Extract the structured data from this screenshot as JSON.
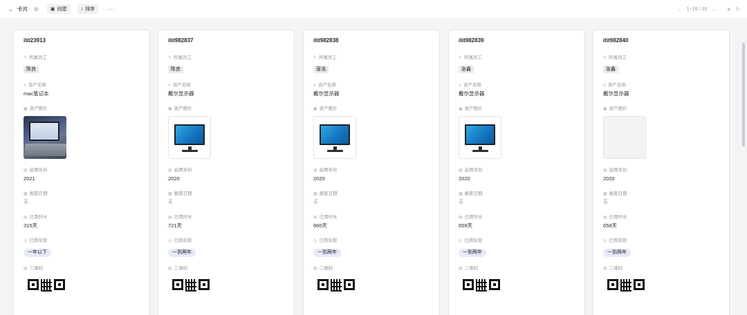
{
  "toolbar": {
    "view_name": "卡片",
    "create_label": "创建",
    "sort_label": "排序",
    "more_label": "···",
    "pagination": "1~16 / 16"
  },
  "fields": {
    "employee": "所属员工",
    "asset_name": "资产名称",
    "asset_image": "资产图片",
    "start_year": "启用年份",
    "scrap_date": "报废日期",
    "used_duration": "已用时长",
    "used_years": "已用年限",
    "qr_code": "二维码"
  },
  "cards": [
    {
      "id": "itit23913",
      "employee": "陈良",
      "asset_name": "mac笔记本",
      "image": "laptop",
      "start_year": "2021",
      "scrap_date": "无",
      "used_duration": "315天",
      "used_years": "一年以下"
    },
    {
      "id": "itit982837",
      "employee": "陈良",
      "asset_name": "戴尔显示器",
      "image": "monitor",
      "start_year": "2020",
      "scrap_date": "无",
      "used_duration": "721天",
      "used_years": "一到两年"
    },
    {
      "id": "itit982838",
      "employee": "唐浩",
      "asset_name": "戴尔显示器",
      "image": "monitor",
      "start_year": "2020",
      "scrap_date": "无",
      "used_duration": "660天",
      "used_years": "一到两年"
    },
    {
      "id": "itit982839",
      "employee": "张鑫",
      "asset_name": "戴尔显示器",
      "image": "monitor",
      "start_year": "2020",
      "scrap_date": "无",
      "used_duration": "659天",
      "used_years": "一到两年"
    },
    {
      "id": "itit982840",
      "employee": "张鑫",
      "asset_name": "戴尔显示器",
      "image": "empty",
      "start_year": "2020",
      "scrap_date": "无",
      "used_duration": "658天",
      "used_years": "一到两年"
    }
  ]
}
